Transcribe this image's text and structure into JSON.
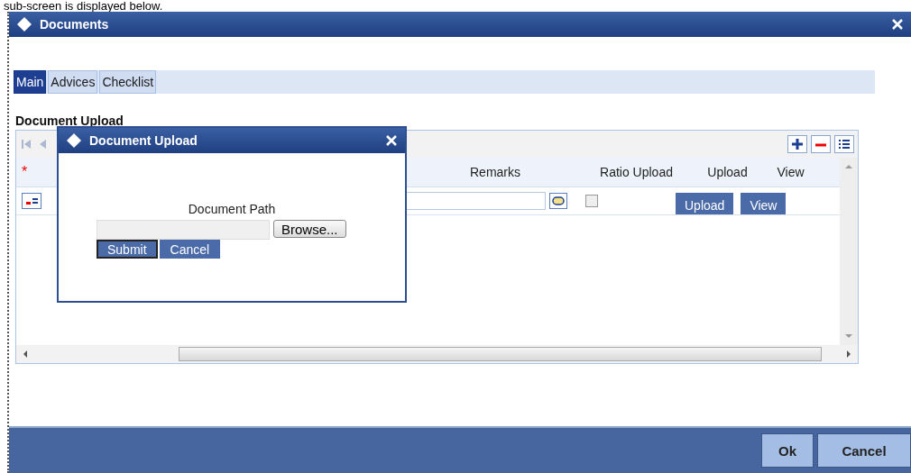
{
  "caption": "sub-screen is displayed below.",
  "window": {
    "title": "Documents"
  },
  "tabs": [
    {
      "label": "Main",
      "selected": true
    },
    {
      "label": "Advices",
      "selected": false
    },
    {
      "label": "Checklist",
      "selected": false
    }
  ],
  "section_title": "Document Upload",
  "grid": {
    "required_mark": "*",
    "columns": [
      "Remarks",
      "Ratio Upload",
      "Upload",
      "View"
    ],
    "rows": [
      {
        "ratio_upload_checked": false,
        "upload": "Upload",
        "view": "View"
      }
    ]
  },
  "dialog": {
    "title": "Document Upload",
    "field_label": "Document Path",
    "browse": "Browse...",
    "buttons": [
      {
        "label": "Submit",
        "focused": true
      },
      {
        "label": "Cancel",
        "focused": false
      }
    ]
  },
  "footer_buttons": [
    "Ok",
    "Cancel"
  ]
}
